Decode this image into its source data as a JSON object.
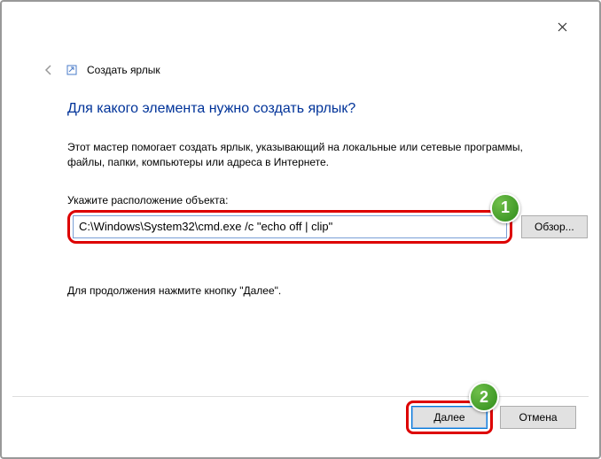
{
  "window": {
    "title": "Создать ярлык"
  },
  "content": {
    "heading": "Для какого элемента нужно создать ярлык?",
    "description": "Этот мастер помогает создать ярлык, указывающий на локальные или сетевые программы, файлы, папки, компьютеры или адреса в Интернете.",
    "field_label": "Укажите расположение объекта:",
    "path_value": "C:\\Windows\\System32\\cmd.exe /c \"echo off | clip\"",
    "browse_label": "Обзор...",
    "continue_hint": "Для продолжения нажмите кнопку \"Далее\"."
  },
  "footer": {
    "next_label": "Далее",
    "cancel_label": "Отмена"
  },
  "badges": {
    "one": "1",
    "two": "2"
  }
}
